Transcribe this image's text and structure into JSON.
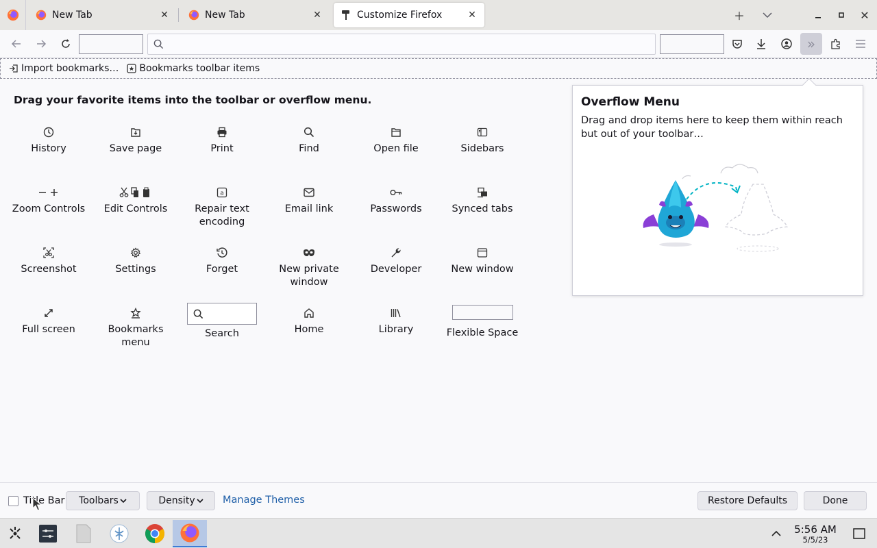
{
  "tabs": [
    {
      "label": "New Tab"
    },
    {
      "label": "New Tab"
    },
    {
      "label": "Customize Firefox"
    }
  ],
  "bookmarks_toolbar": {
    "import_label": "Import bookmarks…",
    "items_label": "Bookmarks toolbar items"
  },
  "customize": {
    "heading": "Drag your favorite items into the toolbar or overflow menu.",
    "palette": [
      {
        "label": "History",
        "icon": "history-icon"
      },
      {
        "label": "Save page",
        "icon": "save-page-icon"
      },
      {
        "label": "Print",
        "icon": "print-icon"
      },
      {
        "label": "Find",
        "icon": "find-icon"
      },
      {
        "label": "Open file",
        "icon": "open-file-icon"
      },
      {
        "label": "Sidebars",
        "icon": "sidebars-icon"
      },
      {
        "label": "Zoom Controls",
        "icon": "zoom-controls-icon"
      },
      {
        "label": "Edit Controls",
        "icon": "edit-controls-icon"
      },
      {
        "label": "Repair text encoding",
        "icon": "repair-text-encoding-icon"
      },
      {
        "label": "Email link",
        "icon": "email-link-icon"
      },
      {
        "label": "Passwords",
        "icon": "passwords-icon"
      },
      {
        "label": "Synced tabs",
        "icon": "synced-tabs-icon"
      },
      {
        "label": "Screenshot",
        "icon": "screenshot-icon"
      },
      {
        "label": "Settings",
        "icon": "settings-icon"
      },
      {
        "label": "Forget",
        "icon": "forget-icon"
      },
      {
        "label": "New private window",
        "icon": "private-window-icon"
      },
      {
        "label": "Developer",
        "icon": "developer-icon"
      },
      {
        "label": "New window",
        "icon": "new-window-icon"
      },
      {
        "label": "Full screen",
        "icon": "full-screen-icon"
      },
      {
        "label": "Bookmarks menu",
        "icon": "bookmarks-menu-icon"
      },
      {
        "label": "Search",
        "icon": "search-icon"
      },
      {
        "label": "Home",
        "icon": "home-icon"
      },
      {
        "label": "Library",
        "icon": "library-icon"
      },
      {
        "label": "Flexible Space",
        "icon": "flexible-space"
      }
    ]
  },
  "overflow_panel": {
    "title": "Overflow Menu",
    "description": "Drag and drop items here to keep them within reach but out of your toolbar…"
  },
  "footer": {
    "title_bar_label": "Title Bar",
    "title_bar_checked": false,
    "toolbars_label": "Toolbars",
    "density_label": "Density",
    "manage_themes_label": "Manage Themes",
    "restore_defaults_label": "Restore Defaults",
    "done_label": "Done"
  },
  "taskbar": {
    "time": "5:56 AM",
    "date": "5/5/23"
  },
  "colors": {
    "accent": "#0060df",
    "link": "#1f5fa8",
    "tab_strip": "#e7e6e3"
  }
}
